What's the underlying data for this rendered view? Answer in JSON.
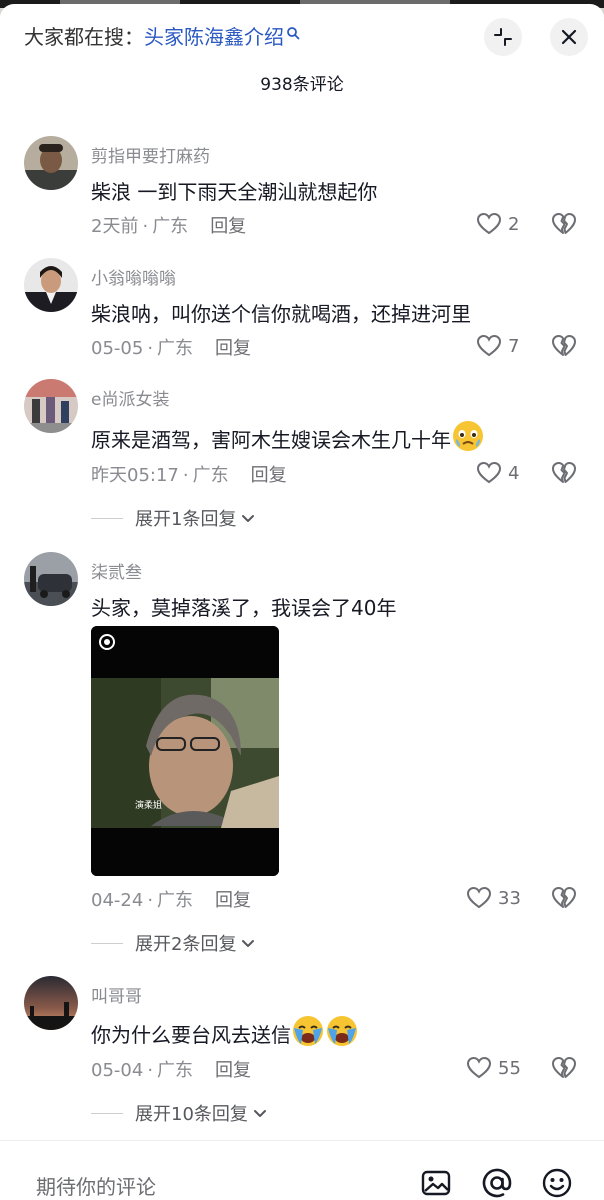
{
  "header": {
    "search_prefix": "大家都在搜：",
    "search_term": "头家陈海鑫介绍",
    "comment_count": "938条评论"
  },
  "comments": [
    {
      "username": "剪指甲要打麻药",
      "text": "柴浪 一到下雨天全潮汕就想起你",
      "time": "2天前",
      "location": "广东",
      "reply_label": "回复",
      "likes": "2"
    },
    {
      "username": "小翁嗡嗡嗡",
      "text": "柴浪呐，叫你送个信你就喝酒，还掉进河里",
      "time": "05-05",
      "location": "广东",
      "reply_label": "回复",
      "likes": "7"
    },
    {
      "username": "e尚派女装",
      "text": "原来是酒驾，害阿木生嫂误会木生几十年",
      "time": "昨天05:17",
      "location": "广东",
      "reply_label": "回复",
      "likes": "4",
      "expand_label": "展开1条回复"
    },
    {
      "username": "柒贰叁",
      "text": "头家，莫掉落溪了，我误会了40年",
      "time": "04-24",
      "location": "广东",
      "reply_label": "回复",
      "likes": "33",
      "expand_label": "展开2条回复",
      "media_caption": "演柔姐"
    },
    {
      "username": "叫哥哥",
      "text": "你为什么要台风去送信",
      "time": "05-04",
      "location": "广东",
      "reply_label": "回复",
      "likes": "55",
      "expand_label": "展开10条回复"
    }
  ],
  "footer": {
    "input_placeholder": "期待你的评论"
  },
  "icons": {
    "search": "search-icon",
    "collapse": "collapse-icon",
    "close": "close-icon",
    "like": "heart-icon",
    "dislike": "broken-heart-icon",
    "expand": "chevron-down-icon",
    "image": "image-icon",
    "mention": "at-icon",
    "emoji": "smiley-icon",
    "crying_emoji": "crying-face-icon",
    "reel": "reel-icon"
  },
  "colors": {
    "accent": "#2b59c3",
    "meta_text": "#8a8b91",
    "body_text": "#161823",
    "emoji_yellow": "#f7c531"
  }
}
